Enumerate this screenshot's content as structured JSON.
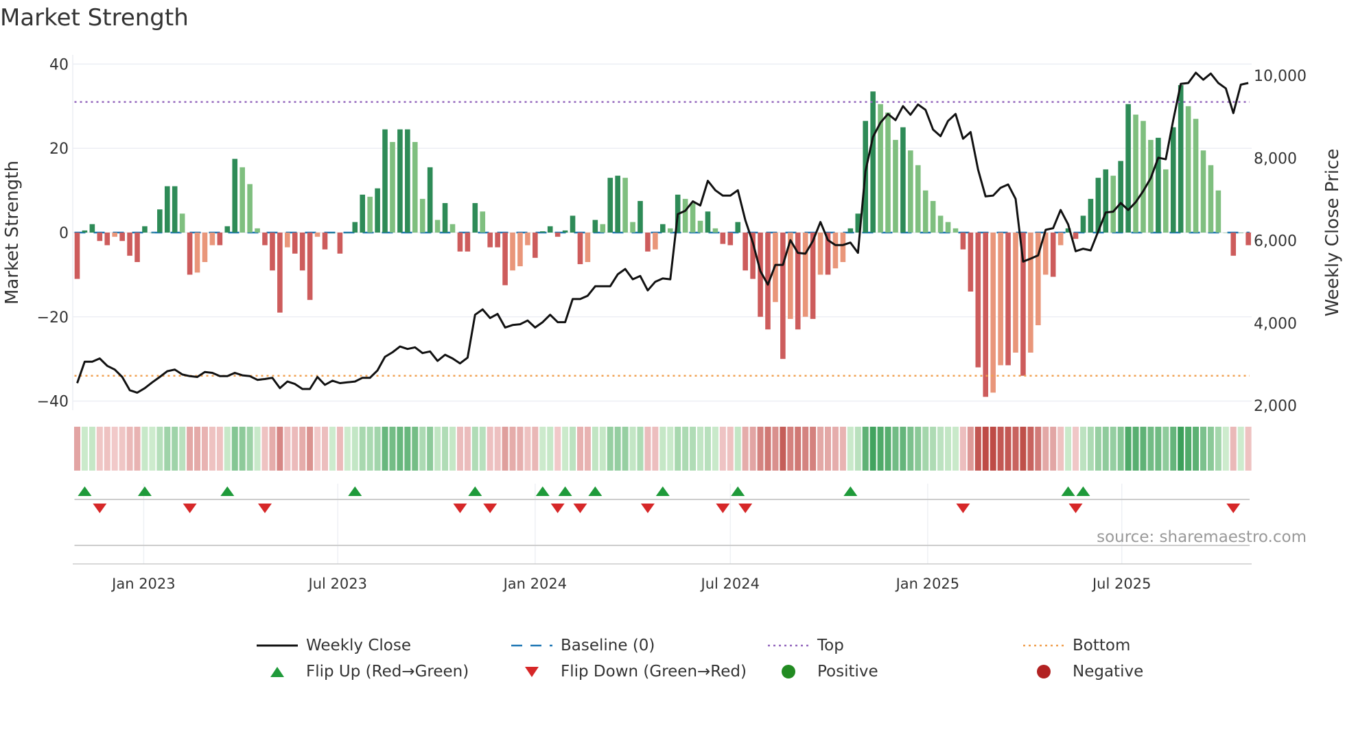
{
  "title": "Market Strength",
  "source": "source: sharemaestro.com",
  "colors": {
    "close": "#111111",
    "baseline": "#1f77b4",
    "top": "#9467bd",
    "bottom": "#f0a050",
    "pos_dark": "#2e8b57",
    "pos_light": "#7fbf7f",
    "neg_dark": "#cd5c5c",
    "neg_light": "#e9967a",
    "flip_up": "#1f9a3a",
    "flip_down": "#d62728",
    "positive": "#228b22",
    "negative": "#b22222"
  },
  "legend": [
    {
      "key": "close",
      "label": "Weekly Close"
    },
    {
      "key": "baseline",
      "label": "Baseline (0)"
    },
    {
      "key": "top",
      "label": "Top"
    },
    {
      "key": "bottom",
      "label": "Bottom"
    },
    {
      "key": "flip_up",
      "label": "Flip Up (Red→Green)"
    },
    {
      "key": "flip_down",
      "label": "Flip Down (Green→Red)"
    },
    {
      "key": "positive",
      "label": "Positive"
    },
    {
      "key": "negative",
      "label": "Negative"
    }
  ],
  "chart_data": {
    "type": "bar",
    "title": "Market Strength",
    "ylabel": "Market Strength",
    "y2label": "Weekly Close Price",
    "ylim": [
      -42,
      42
    ],
    "y2lim": [
      1900,
      10300
    ],
    "yticks": [
      {
        "v": 40,
        "label": "40"
      },
      {
        "v": 20,
        "label": "20"
      },
      {
        "v": 0,
        "label": "0"
      },
      {
        "v": -20,
        "label": "−20"
      },
      {
        "v": -40,
        "label": "−40"
      }
    ],
    "y2ticks": [
      {
        "v": 10000,
        "label": "10,000"
      },
      {
        "v": 8000,
        "label": "8,000"
      },
      {
        "v": 6000,
        "label": "6,000"
      },
      {
        "v": 4000,
        "label": "4,000"
      },
      {
        "v": 2000,
        "label": "2,000"
      }
    ],
    "xticks": [
      {
        "date": "2023-01-01",
        "label": "Jan 2023"
      },
      {
        "date": "2023-07-01",
        "label": "Jul 2023"
      },
      {
        "date": "2024-01-01",
        "label": "Jan 2024"
      },
      {
        "date": "2024-07-01",
        "label": "Jul 2024"
      },
      {
        "date": "2025-01-01",
        "label": "Jan 2025"
      },
      {
        "date": "2025-07-01",
        "label": "Jul 2025"
      }
    ],
    "start_date": "2022-10-31",
    "frequency": "weekly",
    "top_level": 31,
    "bottom_level": -34,
    "baseline": 0,
    "strength": [
      -11,
      0.5,
      2,
      -2,
      -3,
      -1,
      -2,
      -5.5,
      -7,
      1.5,
      0,
      5.5,
      11,
      11,
      4.5,
      -10,
      -9.5,
      -7,
      -3,
      -3,
      1.5,
      17.5,
      15.5,
      11.5,
      1,
      -3,
      -9,
      -19,
      -3.5,
      -5,
      -9,
      -16,
      -1,
      -4,
      0,
      -5,
      0,
      2.5,
      9,
      8.5,
      10.5,
      24.5,
      21.5,
      24.5,
      24.5,
      21.5,
      8,
      15.5,
      3,
      7,
      2,
      -4.5,
      -4.5,
      7,
      5,
      -3.5,
      -3.5,
      -12.5,
      -9,
      -8,
      -3,
      -6,
      0.3,
      1.5,
      -1,
      0.5,
      4,
      -7.5,
      -7,
      3,
      2,
      13,
      13.5,
      13,
      2.5,
      7.5,
      -4.5,
      -4,
      2,
      1,
      9,
      8,
      7,
      2.8,
      5,
      1,
      -2.7,
      -3,
      2.5,
      -9,
      -11,
      -20,
      -23,
      -16.5,
      -30,
      -20.5,
      -23,
      -20,
      -20.5,
      -10,
      -10,
      -8.5,
      -7,
      1,
      4.5,
      26.5,
      33.5,
      30.5,
      28.5,
      22,
      25,
      19.5,
      16,
      10,
      7.5,
      4,
      2.5,
      1,
      -4,
      -14,
      -32,
      -39,
      -38,
      -31.5,
      -31.5,
      -28.5,
      -34,
      -28.5,
      -22,
      -10,
      -10.5,
      -3,
      1,
      -1.5,
      4,
      8,
      13,
      15,
      13.5,
      17,
      30.5,
      28,
      26.5,
      22,
      22.5,
      15,
      25,
      35,
      30,
      27,
      19.5,
      16,
      10,
      0,
      -5.5,
      0,
      -3
    ],
    "close": [
      2540,
      3060,
      3060,
      3140,
      2960,
      2870,
      2690,
      2370,
      2310,
      2420,
      2560,
      2690,
      2830,
      2870,
      2750,
      2710,
      2690,
      2810,
      2790,
      2710,
      2710,
      2790,
      2730,
      2710,
      2620,
      2640,
      2670,
      2420,
      2580,
      2520,
      2400,
      2400,
      2690,
      2500,
      2600,
      2540,
      2560,
      2580,
      2670,
      2670,
      2850,
      3180,
      3290,
      3430,
      3370,
      3410,
      3270,
      3310,
      3080,
      3230,
      3140,
      3020,
      3160,
      4200,
      4330,
      4120,
      4220,
      3890,
      3950,
      3970,
      4060,
      3890,
      4020,
      4200,
      4020,
      4020,
      4580,
      4580,
      4660,
      4890,
      4890,
      4890,
      5180,
      5310,
      5060,
      5140,
      4790,
      5000,
      5080,
      5060,
      6640,
      6720,
      6950,
      6850,
      7450,
      7220,
      7090,
      7090,
      7220,
      6490,
      5950,
      5260,
      4930,
      5410,
      5410,
      6010,
      5700,
      5680,
      5990,
      6450,
      6010,
      5890,
      5890,
      5950,
      5700,
      7680,
      8510,
      8860,
      9070,
      8920,
      9260,
      9050,
      9300,
      9170,
      8690,
      8530,
      8900,
      9070,
      8470,
      8630,
      7720,
      7070,
      7090,
      7280,
      7360,
      7010,
      5490,
      5560,
      5640,
      6260,
      6300,
      6740,
      6390,
      5740,
      5800,
      5760,
      6220,
      6680,
      6700,
      6910,
      6740,
      6930,
      7200,
      7510,
      8010,
      7970,
      8920,
      9800,
      9820,
      10070,
      9900,
      10050,
      9820,
      9690,
      9090,
      9780,
      9820
    ],
    "flip_up_weeks": [
      1,
      9,
      20,
      37,
      53,
      62,
      65,
      69,
      78,
      88,
      103,
      132,
      134
    ],
    "flip_down_weeks": [
      3,
      15,
      25,
      51,
      55,
      64,
      67,
      76,
      86,
      89,
      118,
      133,
      154
    ]
  }
}
